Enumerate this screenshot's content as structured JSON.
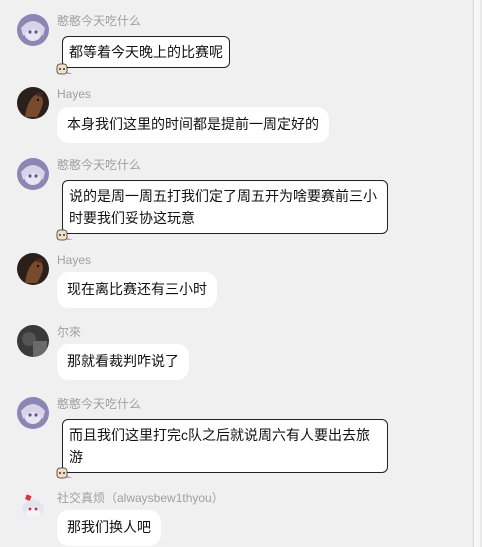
{
  "messages": [
    {
      "sender": "憨憨今天吃什么",
      "text": "都等着今天晚上的比赛呢",
      "avatar": "anime-girl-avatar"
    },
    {
      "sender": "Hayes",
      "text": "本身我们这里的时间都是提前一周定好的",
      "avatar": "horse-avatar"
    },
    {
      "sender": "憨憨今天吃什么",
      "text_line1": "说的是周一周五打我们定了周五开为啥要赛前三小",
      "text_line2": "时要我们妥协这玩意",
      "avatar": "anime-girl-avatar"
    },
    {
      "sender": "Hayes",
      "text": "现在离比赛还有三小时",
      "avatar": "horse-avatar"
    },
    {
      "sender": "尔來",
      "text": "那就看裁判咋说了",
      "avatar": "dark-photo-avatar"
    },
    {
      "sender": "憨憨今天吃什么",
      "text_line1": "而且我们这里打完c队之后就说周六有人要出去旅",
      "text_line2": "游",
      "avatar": "anime-girl-avatar"
    },
    {
      "sender": "社交真烦（alwaysbew1thyou）",
      "text": "那我们换人吧",
      "avatar": "white-hair-girl-avatar"
    }
  ],
  "colors": {
    "background": "#f0f0f0",
    "bubble": "#ffffff",
    "sender_name": "#a0a0a0",
    "bubble_border": "#222222"
  }
}
